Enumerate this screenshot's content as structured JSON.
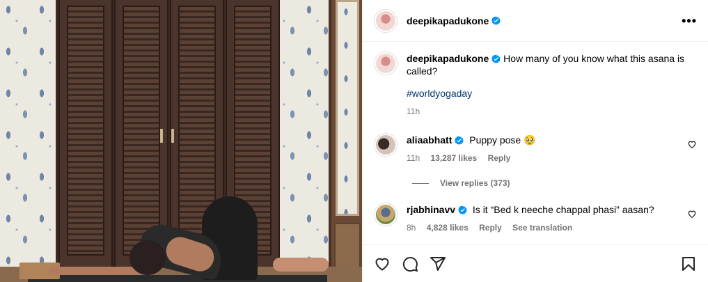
{
  "post": {
    "author": "deepikapadukone",
    "author_verified": true,
    "caption_author": "deepikapadukone",
    "caption_text": "How many of you know what this asana is called?",
    "hashtag": "#worldyogaday",
    "caption_time": "11h"
  },
  "comments": [
    {
      "username": "aliaabhatt",
      "text": "Puppy pose 🥹",
      "time": "11h",
      "likes": "13,287 likes",
      "reply_label": "Reply",
      "view_replies": "View replies (373)"
    },
    {
      "username": "rjabhinavv",
      "text": "Is it “Bed k neeche chappal phasi” aasan?",
      "time": "8h",
      "likes": "4,828 likes",
      "reply_label": "Reply",
      "translate_label": "See translation"
    }
  ],
  "icons": {
    "verified_color": "#0095f6",
    "more": "•••",
    "like": "heart-icon",
    "comment": "comment-icon",
    "share": "share-icon",
    "save": "bookmark-icon"
  }
}
